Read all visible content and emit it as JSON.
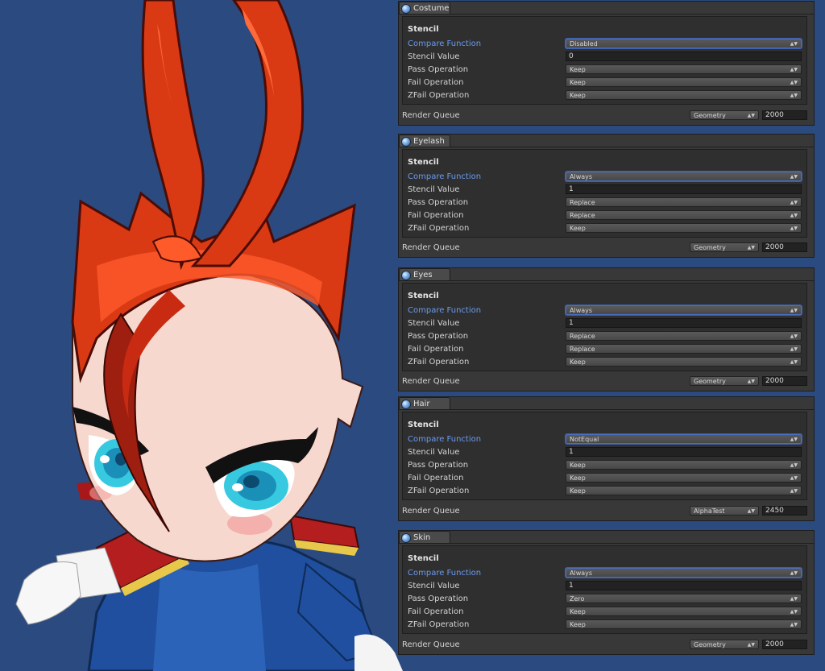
{
  "labels": {
    "stencil_title": "Stencil",
    "compare_function": "Compare Function",
    "stencil_value": "Stencil Value",
    "pass_operation": "Pass Operation",
    "fail_operation": "Fail Operation",
    "zfail_operation": "ZFail Operation",
    "render_queue": "Render Queue"
  },
  "materials": [
    {
      "name": "Costume",
      "compare": "Disabled",
      "value": "0",
      "pass": "Keep",
      "fail": "Keep",
      "zfail": "Keep",
      "queue_type": "Geometry",
      "queue": "2000"
    },
    {
      "name": "Eyelash",
      "compare": "Always",
      "value": "1",
      "pass": "Replace",
      "fail": "Replace",
      "zfail": "Keep",
      "queue_type": "Geometry",
      "queue": "2000"
    },
    {
      "name": "Eyes",
      "compare": "Always",
      "value": "1",
      "pass": "Replace",
      "fail": "Replace",
      "zfail": "Keep",
      "queue_type": "Geometry",
      "queue": "2000"
    },
    {
      "name": "Hair",
      "compare": "NotEqual",
      "value": "1",
      "pass": "Keep",
      "fail": "Keep",
      "zfail": "Keep",
      "queue_type": "AlphaTest",
      "queue": "2450"
    },
    {
      "name": "Skin",
      "compare": "Always",
      "value": "1",
      "pass": "Zero",
      "fail": "Keep",
      "zfail": "Keep",
      "queue_type": "Geometry",
      "queue": "2000"
    }
  ],
  "colors": {
    "background": "#2b4a80",
    "hair": "#d93a14",
    "skin": "#f7d8cf",
    "suit": "#1f4f9e",
    "eye": "#37c9e0"
  },
  "icons": {
    "material": "material-sphere-icon",
    "dropdown": "updown-arrow-icon"
  }
}
